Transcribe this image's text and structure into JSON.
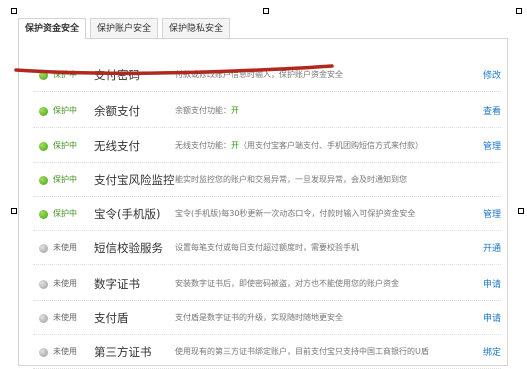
{
  "tabs": [
    {
      "label": "保护资金安全"
    },
    {
      "label": "保护账户安全"
    },
    {
      "label": "保护隐私安全"
    }
  ],
  "rows": [
    {
      "status": "保护中",
      "on": true,
      "name": "支付密码",
      "desc": "付款或修改账户信息时输入，保护账户资金安全",
      "desc_highlight": "",
      "action": "修改"
    },
    {
      "status": "保护中",
      "on": true,
      "name": "余额支付",
      "desc": "余额支付功能：",
      "desc_highlight": "开",
      "action": "查看"
    },
    {
      "status": "保护中",
      "on": true,
      "name": "无线支付",
      "desc": "无线支付功能：",
      "desc_highlight": "开",
      "desc_tail": "（用支付宝客户端支付、手机团购短信方式来付款）",
      "action": "管理"
    },
    {
      "status": "保护中",
      "on": true,
      "name": "支付宝风险监控",
      "desc": "能实时监控您的账户和交易异常，一旦发现异常，会及时通知到您",
      "desc_highlight": "",
      "action": ""
    },
    {
      "status": "保护中",
      "on": true,
      "name": "宝令(手机版)",
      "desc": "宝令(手机版)每30秒更新一次动态口令，付款时输入可保护资金安全",
      "desc_highlight": "",
      "action": "管理"
    },
    {
      "status": "未使用",
      "on": false,
      "name": "短信校验服务",
      "desc": "设置每笔支付或每日支付超过额度时，需要校验手机",
      "desc_highlight": "",
      "action": "开通"
    },
    {
      "status": "未使用",
      "on": false,
      "name": "数字证书",
      "desc": "安装数字证书后，即使密码被盗，对方也不能使用您的账户资金",
      "desc_highlight": "",
      "action": "申请"
    },
    {
      "status": "未使用",
      "on": false,
      "name": "支付盾",
      "desc": "支付盾是数字证书的升级，实现随时随地更安全",
      "desc_highlight": "",
      "action": "申请"
    },
    {
      "status": "未使用",
      "on": false,
      "name": "第三方证书",
      "desc": "使用现有的第三方证书绑定账户，目前支付宝只支持中国工商银行的U盾",
      "desc_highlight": "",
      "action": "绑定"
    }
  ],
  "colors": {
    "protected": "#3f8f1b",
    "link": "#1b76c9",
    "annotation": "#b2281e"
  }
}
